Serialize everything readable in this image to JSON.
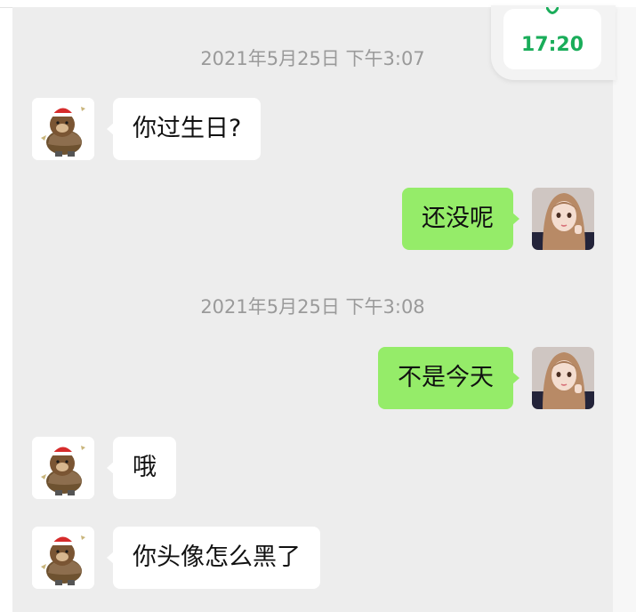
{
  "status": {
    "time": "17:20"
  },
  "chat": {
    "timestamps": [
      "2021年5月25日 下午3:07",
      "2021年5月25日 下午3:08"
    ],
    "messages": [
      {
        "sender": "contact",
        "text": "你过生日?"
      },
      {
        "sender": "self",
        "text": "还没呢"
      },
      {
        "sender": "self",
        "text": "不是今天"
      },
      {
        "sender": "contact",
        "text": "哦"
      },
      {
        "sender": "contact",
        "text": "你头像怎么黑了"
      }
    ]
  },
  "avatars": {
    "contact": "brown-bear-santa-hat-avatar",
    "self": "anime-girl-avatar"
  },
  "colors": {
    "background": "#ededed",
    "incoming_bubble": "#ffffff",
    "outgoing_bubble": "#95ec69",
    "timestamp_text": "#9a9a9a",
    "widget_time": "#1aad5a",
    "tab_accent": "#f2713a"
  }
}
